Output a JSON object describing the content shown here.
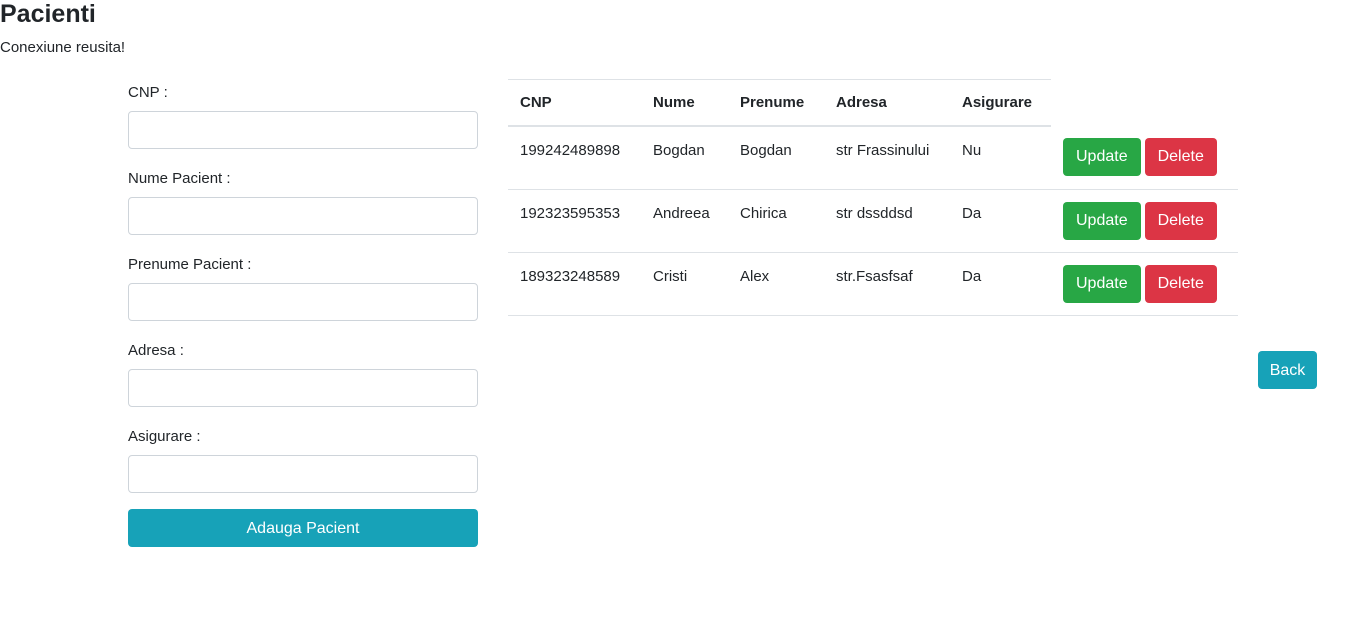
{
  "page": {
    "title": "Pacienti",
    "status": "Conexiune reusita!"
  },
  "form": {
    "fields": [
      {
        "label": "CNP :",
        "value": ""
      },
      {
        "label": "Nume Pacient :",
        "value": ""
      },
      {
        "label": "Prenume Pacient :",
        "value": ""
      },
      {
        "label": "Adresa :",
        "value": ""
      },
      {
        "label": "Asigurare :",
        "value": ""
      }
    ],
    "submit_label": "Adauga Pacient"
  },
  "table": {
    "columns": [
      "CNP",
      "Nume",
      "Prenume",
      "Adresa",
      "Asigurare"
    ],
    "rows": [
      {
        "cnp": "199242489898",
        "nume": "Bogdan",
        "prenume": "Bogdan",
        "adresa": "str Frassinului",
        "asigurare": "Nu",
        "update_label": "Update",
        "delete_label": "Delete"
      },
      {
        "cnp": "192323595353",
        "nume": "Andreea",
        "prenume": "Chirica",
        "adresa": "str dssddsd",
        "asigurare": "Da",
        "update_label": "Update",
        "delete_label": "Delete"
      },
      {
        "cnp": "189323248589",
        "nume": "Cristi",
        "prenume": "Alex",
        "adresa": "str.Fsasfsaf",
        "asigurare": "Da",
        "update_label": "Update",
        "delete_label": "Delete"
      }
    ]
  },
  "back_label": "Back",
  "colors": {
    "primary_info": "#17a2b8",
    "success": "#28a745",
    "danger": "#dc3545",
    "text": "#212529",
    "border": "#dee2e6"
  }
}
